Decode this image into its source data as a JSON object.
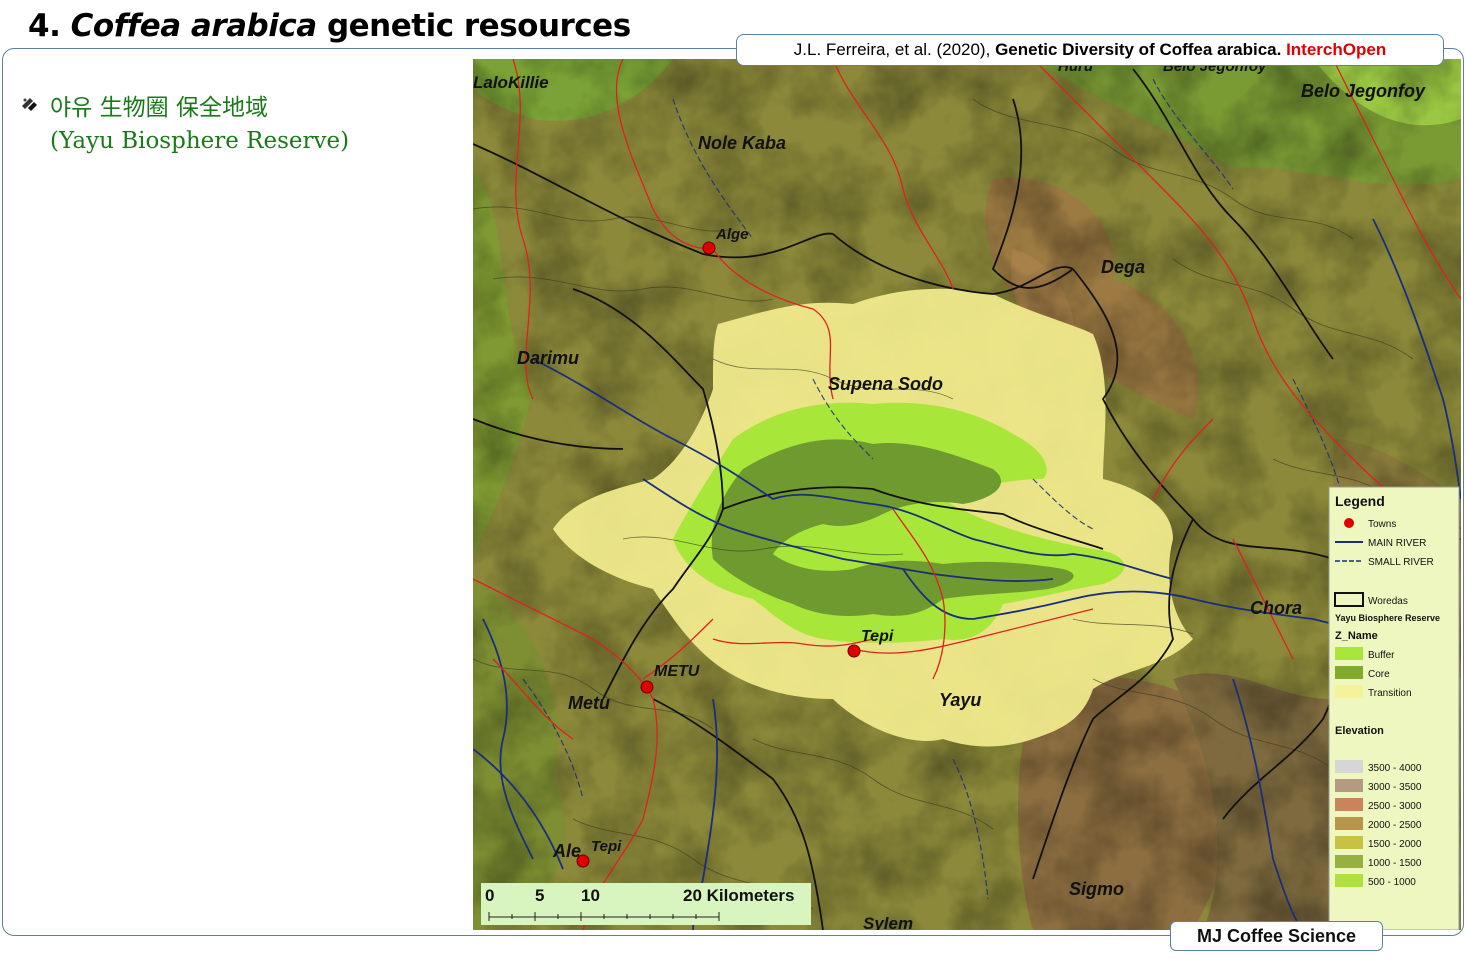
{
  "slide": {
    "number": "4.",
    "title_italic": "Coffea arabica",
    "title_rest": "genetic resources"
  },
  "citation": {
    "authors": "J.L. Ferreira,  et al. (2020),",
    "title": "Genetic Diversity of Coffea arabica.",
    "publisher": "InterchOpen"
  },
  "bullet": {
    "line1": "야유 生物圈 保全地域",
    "line2": "(Yayu Biosphere Reserve)"
  },
  "map": {
    "places": {
      "lalokillie": "LaloKillie",
      "nole_kaba": "Nole Kaba",
      "hurit": "Huru",
      "belo_jegonfoy_top": "Belo Jegonfoy",
      "belo_jegonfoy": "Belo Jegonfoy",
      "alge": "Alge",
      "dega": "Dega",
      "darimu": "Darimu",
      "supena_sodo": "Supena Sodo",
      "chora": "Chora",
      "tepi": "Tepi",
      "metu_town": "METU",
      "metu": "Metu",
      "yayu": "Yayu",
      "ale": "Ale",
      "ale_tepi": "Tepi",
      "sigmo": "Sigmo",
      "sylem": "Sylem"
    },
    "scale_bar": {
      "t0": "0",
      "t5": "5",
      "t10": "10",
      "t20": "20 Kilometers"
    },
    "legend": {
      "title": "Legend",
      "towns": "Towns",
      "main_river": "MAIN RIVER",
      "small_river": "SMALL RIVER",
      "woredas": "Woredas",
      "reserve": "Yayu Biosphere Reserve",
      "zname": "Z_Name",
      "zones": [
        {
          "label": "Buffer",
          "color": "#a8e63a"
        },
        {
          "label": "Core",
          "color": "#7faa2c"
        },
        {
          "label": "Transition",
          "color": "#f4f29a"
        }
      ],
      "elevation_title": "Elevation",
      "elevation": [
        {
          "label": "3500 - 4000",
          "color": "#d6d6d6"
        },
        {
          "label": "3000 - 3500",
          "color": "#b49a80"
        },
        {
          "label": "2500 - 3000",
          "color": "#c8845a"
        },
        {
          "label": "2000 - 2500",
          "color": "#b8954a"
        },
        {
          "label": "1500 - 2000",
          "color": "#c8c244"
        },
        {
          "label": "1000 - 1500",
          "color": "#98b040"
        },
        {
          "label": "500 - 1000",
          "color": "#b0e040"
        }
      ]
    }
  },
  "footer": "MJ Coffee Science"
}
